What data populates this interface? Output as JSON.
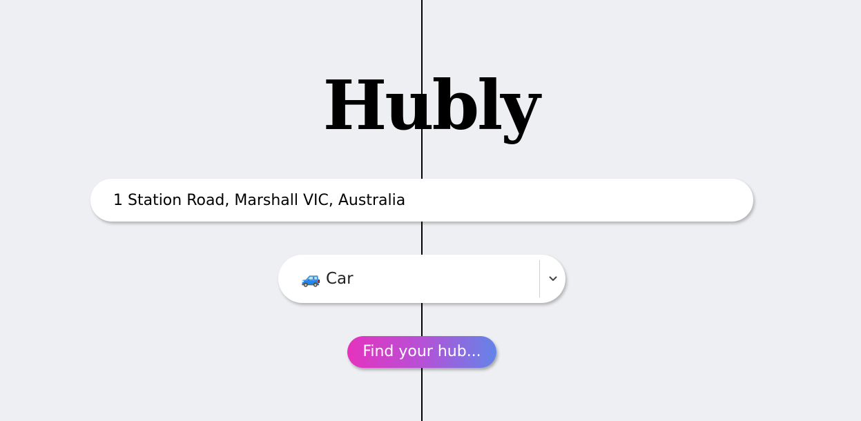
{
  "app": {
    "title": "Hubly"
  },
  "form": {
    "address_value": "1 Station Road, Marshall VIC, Australia",
    "transport_mode": {
      "selected_label": "🚙 Car",
      "icon": "suv-car-emoji"
    },
    "submit_label": "Find your hub..."
  },
  "colors": {
    "background": "#eeeff2",
    "button_gradient_start": "#e433be",
    "button_gradient_end": "#6384e8"
  }
}
